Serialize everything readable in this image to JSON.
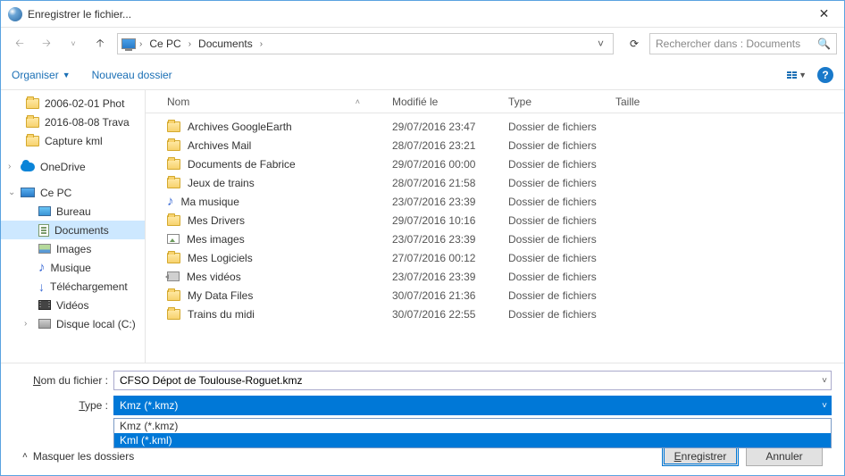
{
  "window": {
    "title": "Enregistrer le fichier..."
  },
  "breadcrumb": {
    "root": "Ce PC",
    "folder": "Documents"
  },
  "search": {
    "placeholder": "Rechercher dans : Documents"
  },
  "toolbar": {
    "organize": "Organiser",
    "newfolder": "Nouveau dossier"
  },
  "columns": {
    "nom": "Nom",
    "mod": "Modifié le",
    "typ": "Type",
    "tai": "Taille"
  },
  "tree": {
    "items": [
      {
        "label": "2006-02-01 Phot",
        "icon": "folder"
      },
      {
        "label": "2016-08-08 Trava",
        "icon": "folder"
      },
      {
        "label": "Capture kml",
        "icon": "folder"
      }
    ],
    "onedrive": "OneDrive",
    "cepc": "Ce PC",
    "subs": [
      {
        "label": "Bureau",
        "icon": "desk"
      },
      {
        "label": "Documents",
        "icon": "doc",
        "sel": true
      },
      {
        "label": "Images",
        "icon": "img"
      },
      {
        "label": "Musique",
        "icon": "music"
      },
      {
        "label": "Téléchargement",
        "icon": "dl"
      },
      {
        "label": "Vidéos",
        "icon": "vid"
      },
      {
        "label": "Disque local (C:)",
        "icon": "disk"
      }
    ]
  },
  "files": [
    {
      "name": "Archives GoogleEarth",
      "mod": "29/07/2016 23:47",
      "typ": "Dossier de fichiers",
      "icon": "folder"
    },
    {
      "name": "Archives Mail",
      "mod": "28/07/2016 23:21",
      "typ": "Dossier de fichiers",
      "icon": "folder"
    },
    {
      "name": "Documents de Fabrice",
      "mod": "29/07/2016 00:00",
      "typ": "Dossier de fichiers",
      "icon": "folder"
    },
    {
      "name": "Jeux de trains",
      "mod": "28/07/2016 21:58",
      "typ": "Dossier de fichiers",
      "icon": "folder"
    },
    {
      "name": "Ma musique",
      "mod": "23/07/2016 23:39",
      "typ": "Dossier de fichiers",
      "icon": "music"
    },
    {
      "name": "Mes Drivers",
      "mod": "29/07/2016 10:16",
      "typ": "Dossier de fichiers",
      "icon": "folder"
    },
    {
      "name": "Mes images",
      "mod": "23/07/2016 23:39",
      "typ": "Dossier de fichiers",
      "icon": "img"
    },
    {
      "name": "Mes Logiciels",
      "mod": "27/07/2016 00:12",
      "typ": "Dossier de fichiers",
      "icon": "folder"
    },
    {
      "name": "Mes vidéos",
      "mod": "23/07/2016 23:39",
      "typ": "Dossier de fichiers",
      "icon": "vid"
    },
    {
      "name": "My Data Files",
      "mod": "30/07/2016 21:36",
      "typ": "Dossier de fichiers",
      "icon": "folder"
    },
    {
      "name": "Trains du midi",
      "mod": "30/07/2016 22:55",
      "typ": "Dossier de fichiers",
      "icon": "folder"
    }
  ],
  "form": {
    "filename_label_pre": "Nom du fichier :",
    "filename_value": "CFSO  Dépot de Toulouse-Roguet.kmz",
    "type_label": "Type :",
    "type_value": "Kmz (*.kmz)",
    "options": [
      "Kmz (*.kmz)",
      "Kml (*.kml)"
    ]
  },
  "footer": {
    "hide": "Masquer les dossiers",
    "save": "Enregistrer",
    "cancel": "Annuler"
  }
}
